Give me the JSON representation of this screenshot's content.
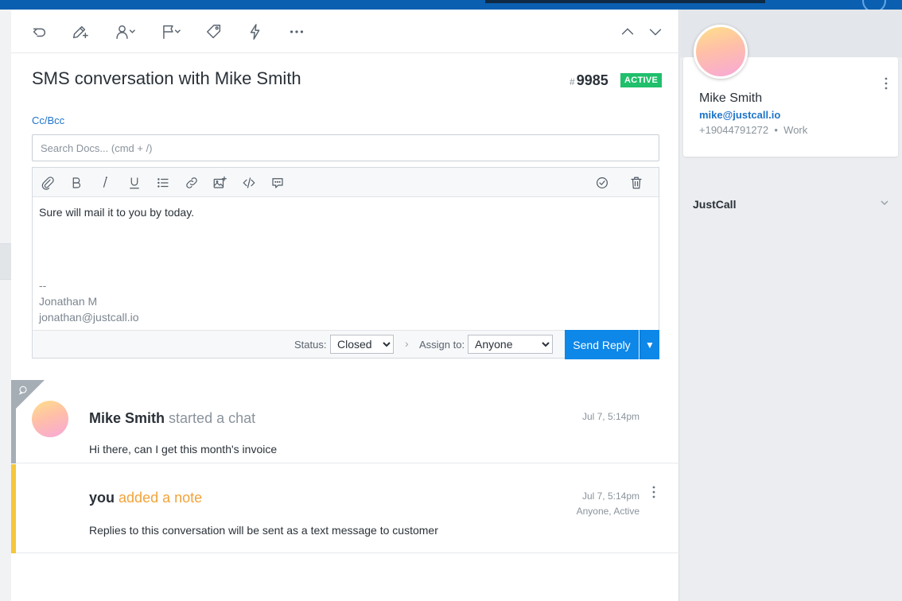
{
  "toolbar": {
    "icons": [
      "undo-icon",
      "edit-icon",
      "assign-agent-icon",
      "flag-icon",
      "tag-icon",
      "lightning-icon",
      "more-icon",
      "chevron-up-icon",
      "chevron-down-icon"
    ]
  },
  "ticket": {
    "title": "SMS conversation with Mike Smith",
    "number_hash": "#",
    "number": "9985",
    "status_badge": "ACTIVE",
    "status_badge_color": "#1fbf6b"
  },
  "reply": {
    "cc_bcc_label": "Cc/Bcc",
    "search_placeholder": "Search Docs... (cmd + /)",
    "body_text": "Sure will mail it to you by today.",
    "signature": {
      "separator": "--",
      "name": "Jonathan M",
      "email": "jonathan@justcall.io"
    },
    "status_label": "Status:",
    "status_value": "Closed",
    "assign_label": "Assign to:",
    "assign_value": "Anyone",
    "send_label": "Send Reply",
    "send_color": "#0d87e8"
  },
  "activity": [
    {
      "who": "Mike Smith",
      "verb": "started a chat",
      "time": "Jul 7, 5:14pm",
      "message": "Hi there, can I get this month's invoice"
    },
    {
      "who": "you",
      "verb": "added a note",
      "time": "Jul 7, 5:14pm",
      "sub": "Anyone, Active",
      "message": "Replies to this conversation will be sent as a text message to customer"
    }
  ],
  "contact": {
    "name": "Mike Smith",
    "email": "mike@justcall.io",
    "phone": "+19044791272",
    "phone_separator": "•",
    "phone_type": "Work"
  },
  "integrations": {
    "justcall_label": "JustCall"
  }
}
